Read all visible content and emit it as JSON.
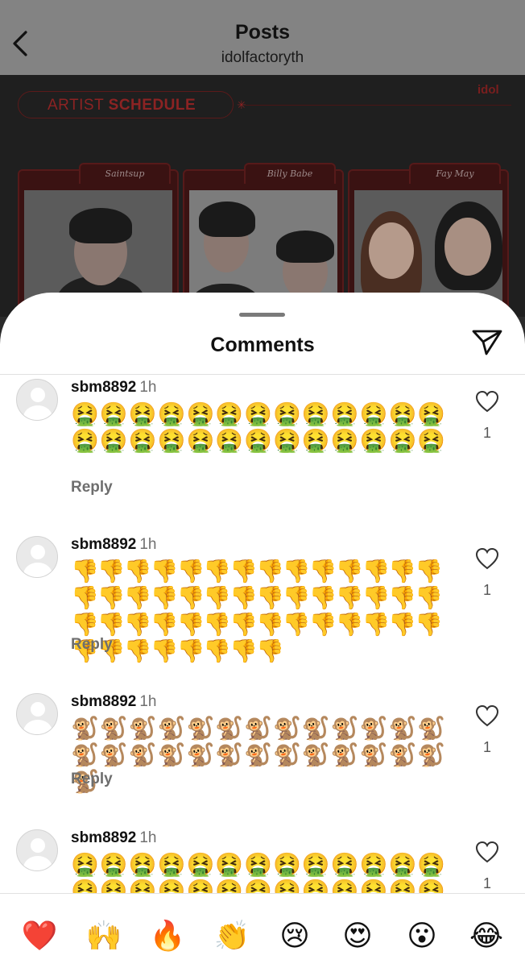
{
  "header": {
    "title": "Posts",
    "subtitle": "idolfactoryth"
  },
  "post": {
    "schedule_prefix": "ARTIST",
    "schedule_bold": "SCHEDULE",
    "brand": "idol",
    "cards": [
      {
        "name": "Saintsup"
      },
      {
        "name": "Billy Babe"
      },
      {
        "name": "Fay May"
      }
    ]
  },
  "comments_sheet": {
    "title": "Comments",
    "reply_label": "Reply",
    "comments": [
      {
        "username": "sbm8892",
        "time": "1h",
        "text": "🤮🤮🤮🤮🤮🤮🤮🤮🤮🤮🤮🤮🤮🤮🤮🤮🤮🤮🤮🤮🤮🤮🤮🤮🤮🤮",
        "likes": "1"
      },
      {
        "username": "sbm8892",
        "time": "1h",
        "text": "👎👎👎👎👎👎👎👎👎👎👎👎👎👎👎👎👎👎👎👎👎👎👎👎👎👎👎👎👎👎👎👎👎👎👎👎👎👎👎👎👎👎👎👎👎👎👎👎👎👎",
        "likes": "1"
      },
      {
        "username": "sbm8892",
        "time": "1h",
        "text": "🐒🐒🐒🐒🐒🐒🐒🐒🐒🐒🐒🐒🐒🐒🐒🐒🐒🐒🐒🐒🐒🐒🐒🐒🐒🐒🐒",
        "likes": "1"
      },
      {
        "username": "sbm8892",
        "time": "1h",
        "text": "🤮🤮🤮🤮🤮🤮🤮🤮🤮🤮🤮🤮🤮🤮🤮🤮🤮🤮🤮🤮🤮🤮🤮🤮🤮🤮",
        "likes": "1"
      }
    ]
  },
  "reactions": [
    "❤️",
    "🙌",
    "🔥",
    "👏",
    "😢",
    "😍",
    "😮",
    "😂"
  ],
  "colors": {
    "header_bg": "#838383",
    "sheet_bg": "#ffffff",
    "post_accent": "#8c2323",
    "reply_text": "#6e6e6e"
  },
  "icons": {
    "back": "chevron-left-icon",
    "send": "paper-plane-icon",
    "like": "heart-outline-icon",
    "avatar": "default-avatar-icon"
  }
}
